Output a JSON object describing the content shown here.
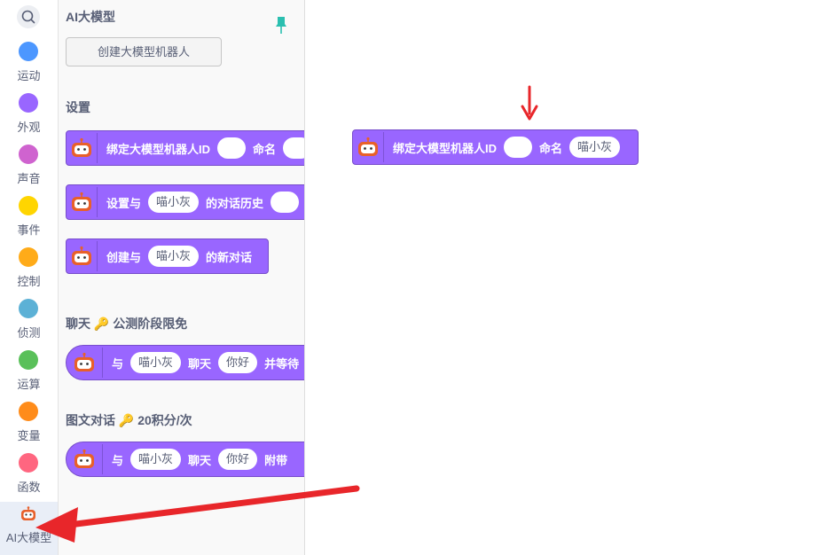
{
  "categories": [
    {
      "label": "运动",
      "color": "#4c97ff",
      "name": "category-motion"
    },
    {
      "label": "外观",
      "color": "#9966ff",
      "name": "category-looks"
    },
    {
      "label": "声音",
      "color": "#cf63cf",
      "name": "category-sound"
    },
    {
      "label": "事件",
      "color": "#ffd500",
      "name": "category-events"
    },
    {
      "label": "控制",
      "color": "#ffab19",
      "name": "category-control"
    },
    {
      "label": "侦测",
      "color": "#5cb1d6",
      "name": "category-sensing"
    },
    {
      "label": "运算",
      "color": "#59c059",
      "name": "category-operators"
    },
    {
      "label": "变量",
      "color": "#ff8c1a",
      "name": "category-variables"
    },
    {
      "label": "函数",
      "color": "#ff6680",
      "name": "category-functions"
    }
  ],
  "ai_category": {
    "label": "AI大模型"
  },
  "palette": {
    "title": "AI大模型",
    "create_button": "创建大模型机器人",
    "section_settings": "设置",
    "section_chat": "聊天",
    "section_chat_note": "公测阶段限免",
    "section_image": "图文对话",
    "section_image_note": "20积分/次",
    "block_bind": {
      "label": "绑定大模型机器人ID",
      "name_label": "命名"
    },
    "block_set": {
      "prefix": "设置与",
      "bot": "喵小灰",
      "suffix": "的对话历史"
    },
    "block_new": {
      "prefix": "创建与",
      "bot": "喵小灰",
      "suffix": "的新对话"
    },
    "block_chat": {
      "with": "与",
      "bot": "喵小灰",
      "chat": "聊天",
      "msg": "你好",
      "tail": "并等待"
    },
    "block_image": {
      "with": "与",
      "bot": "喵小灰",
      "chat": "聊天",
      "msg": "你好",
      "tail": "附带"
    }
  },
  "workspace": {
    "block_bind": {
      "label": "绑定大模型机器人ID",
      "name_label": "命名",
      "bot": "喵小灰"
    }
  },
  "colors": {
    "block": "#9966ff",
    "block_border": "#774dcb",
    "arrow": "#e8262a"
  }
}
